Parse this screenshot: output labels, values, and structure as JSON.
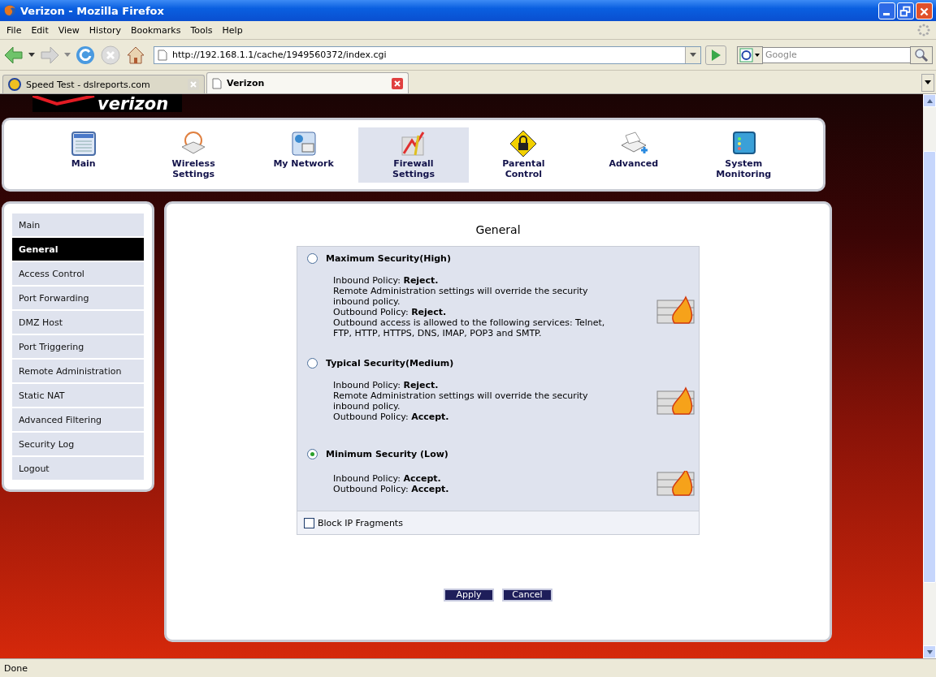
{
  "window": {
    "title": "Verizon - Mozilla Firefox"
  },
  "menu": [
    "File",
    "Edit",
    "View",
    "History",
    "Bookmarks",
    "Tools",
    "Help"
  ],
  "address": {
    "value": "http://192.168.1.1/cache/1949560372/index.cgi"
  },
  "search": {
    "placeholder": "Google"
  },
  "tabs": [
    {
      "label": "Speed Test - dslreports.com",
      "selected": false
    },
    {
      "label": "Verizon",
      "selected": true
    }
  ],
  "logo": "verizon",
  "nav": [
    {
      "label": "Main",
      "selected": false
    },
    {
      "label": "Wireless\nSettings",
      "selected": false
    },
    {
      "label": "My Network",
      "selected": false
    },
    {
      "label": "Firewall\nSettings",
      "selected": true
    },
    {
      "label": "Parental\nControl",
      "selected": false
    },
    {
      "label": "Advanced",
      "selected": false
    },
    {
      "label": "System\nMonitoring",
      "selected": false
    }
  ],
  "sidebar": [
    {
      "label": "Main",
      "selected": false
    },
    {
      "label": "General",
      "selected": true
    },
    {
      "label": "Access Control",
      "selected": false
    },
    {
      "label": "Port Forwarding",
      "selected": false
    },
    {
      "label": "DMZ Host",
      "selected": false
    },
    {
      "label": "Port Triggering",
      "selected": false
    },
    {
      "label": "Remote Administration",
      "selected": false
    },
    {
      "label": "Static NAT",
      "selected": false
    },
    {
      "label": "Advanced Filtering",
      "selected": false
    },
    {
      "label": "Security Log",
      "selected": false
    },
    {
      "label": "Logout",
      "selected": false
    }
  ],
  "panel": {
    "title": "General",
    "options": [
      {
        "label": "Maximum Security(High)",
        "selected": false,
        "lines": [
          "Inbound Policy: **Reject.**",
          "Remote Administration settings will override the security inbound policy.",
          "Outbound Policy: **Reject.**",
          "Outbound access is allowed to the following services: Telnet, FTP, HTTP, HTTPS, DNS, IMAP, POP3 and SMTP."
        ]
      },
      {
        "label": "Typical Security(Medium)",
        "selected": false,
        "lines": [
          "Inbound Policy: **Reject.**",
          "Remote Administration settings will override the security inbound policy.",
          "Outbound Policy: **Accept.**"
        ]
      },
      {
        "label": "Minimum Security (Low)",
        "selected": true,
        "lines": [
          "Inbound Policy: **Accept.**",
          "Outbound Policy: **Accept.**"
        ]
      }
    ],
    "block_ip_fragments": {
      "label": "Block IP Fragments",
      "checked": false
    },
    "buttons": [
      "Apply",
      "Cancel"
    ]
  },
  "status_bar": "Done"
}
